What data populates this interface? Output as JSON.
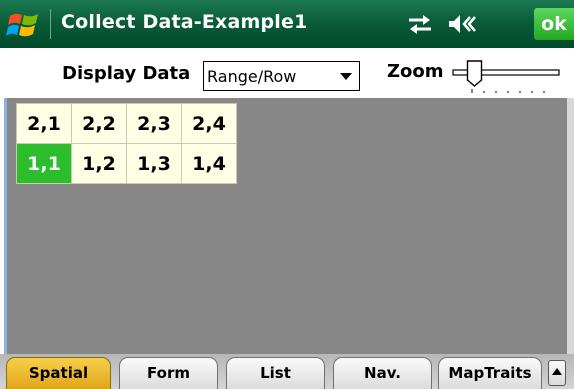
{
  "titlebar": {
    "title": "Collect Data-Example1",
    "ok_label": "ok",
    "icons": [
      "windows-start-icon",
      "connectivity-icon",
      "volume-icon"
    ],
    "colors": {
      "bar": "#0a5c3a",
      "ok": "#22a822"
    }
  },
  "toolbar": {
    "display_label": "Display Data",
    "display_select_value": "Range/Row",
    "zoom_label": "Zoom",
    "zoom_level": 0.15
  },
  "grid": {
    "rows": [
      [
        {
          "label": "2,1"
        },
        {
          "label": "2,2"
        },
        {
          "label": "2,3"
        },
        {
          "label": "2,4"
        }
      ],
      [
        {
          "label": "1,1",
          "selected": true
        },
        {
          "label": "1,2"
        },
        {
          "label": "1,3"
        },
        {
          "label": "1,4"
        }
      ]
    ],
    "colors": {
      "cell": "#ffffe6",
      "selected": "#2bbd2b",
      "background": "#878787"
    }
  },
  "tabs": [
    {
      "label": "Spatial",
      "active": true
    },
    {
      "label": "Form",
      "active": false
    },
    {
      "label": "List",
      "active": false
    },
    {
      "label": "Nav.",
      "active": false
    },
    {
      "label": "MapTraits",
      "active": false
    }
  ]
}
